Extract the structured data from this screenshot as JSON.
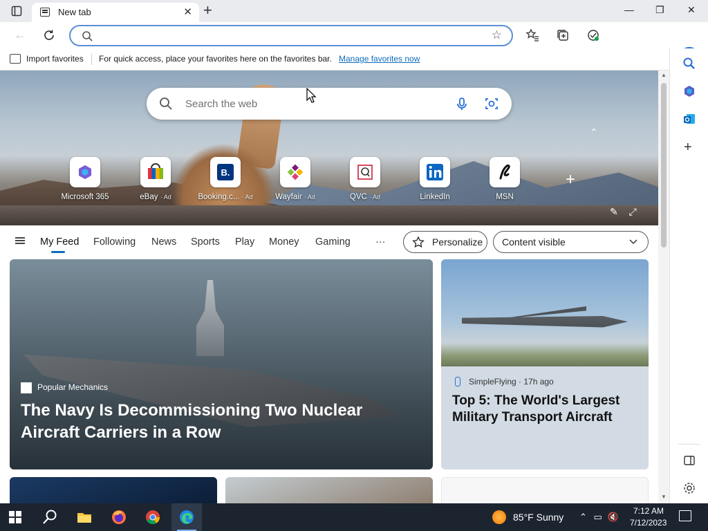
{
  "tab": {
    "title": "New tab",
    "close": "✕",
    "new_tab": "+"
  },
  "window": {
    "minimize": "—",
    "restore": "❐",
    "close": "✕"
  },
  "address_bar": {
    "value": "",
    "placeholder": ""
  },
  "toolbar": {
    "more": "···",
    "bing": "b"
  },
  "favorites_bar": {
    "import_label": "Import favorites",
    "message": "For quick access, place your favorites here on the favorites bar.",
    "link": "Manage favorites now"
  },
  "web_search": {
    "placeholder": "Search the web"
  },
  "quick_links": [
    {
      "label": "Microsoft 365",
      "ad": ""
    },
    {
      "label": "eBay",
      "ad": "· Ad"
    },
    {
      "label": "Booking.c...",
      "ad": "· Ad"
    },
    {
      "label": "Wayfair",
      "ad": "· Ad"
    },
    {
      "label": "QVC",
      "ad": "· Ad"
    },
    {
      "label": "LinkedIn",
      "ad": ""
    },
    {
      "label": "MSN",
      "ad": ""
    }
  ],
  "feed_nav": {
    "items": [
      "My Feed",
      "Following",
      "News",
      "Sports",
      "Play",
      "Money",
      "Gaming"
    ],
    "more": "···",
    "personalize": "Personalize",
    "content_visibility": "Content visible"
  },
  "cards": {
    "main": {
      "source": "Popular Mechanics",
      "headline": "The Navy Is Decommissioning Two Nuclear Aircraft Carriers in a Row"
    },
    "side": {
      "source": "SimpleFlying · 17h ago",
      "headline": "Top 5: The World's Largest Military Transport Aircraft"
    }
  },
  "taskbar": {
    "weather": "85°F  Sunny",
    "time": "7:12 AM",
    "date": "7/12/2023"
  },
  "colors": {
    "accent": "#0f6cbd",
    "taskbar": "#1c2430"
  }
}
